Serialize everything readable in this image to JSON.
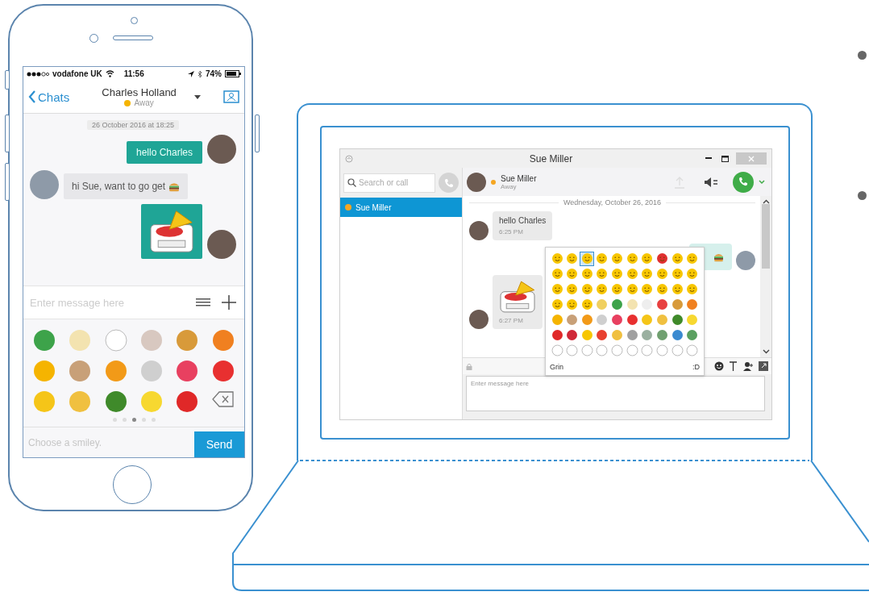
{
  "phone": {
    "status_bar": {
      "carrier": "vodafone UK",
      "time": "11:56",
      "battery": "74%"
    },
    "nav": {
      "back": "Chats",
      "contact_name": "Charles Holland",
      "presence": {
        "label": "Away",
        "color": "#f5b400"
      }
    },
    "date_label": "26 October 2016 at 18:25",
    "messages": [
      {
        "kind": "text",
        "outgoing": true,
        "text": "hello Charles"
      },
      {
        "kind": "text_emoji",
        "outgoing": false,
        "text": "hi Sue, want to go get"
      },
      {
        "kind": "sticker",
        "outgoing": true
      }
    ],
    "composer": {
      "placeholder": "Enter message here"
    },
    "emoji_pages": [
      {
        "selected": false
      },
      {
        "selected": false
      },
      {
        "selected": true
      },
      {
        "selected": false
      },
      {
        "selected": false
      }
    ],
    "footer": {
      "placeholder": "Choose a smiley.",
      "send": "Send"
    }
  },
  "desktop": {
    "window_title": "Sue Miller",
    "search": {
      "placeholder": "Search or call"
    },
    "contacts": [
      {
        "name": "Sue Miller",
        "selected": true,
        "color": "#f5a623"
      }
    ],
    "header": {
      "name": "Sue Miller",
      "presence": "Away",
      "color": "#f5a623"
    },
    "date_label": "Wednesday, October 26, 2016",
    "messages": [
      {
        "kind": "text",
        "outgoing": false,
        "text": "hello Charles",
        "time": "6:25 PM"
      },
      {
        "kind": "emoji",
        "outgoing": true
      },
      {
        "kind": "sticker",
        "outgoing": false,
        "time": "6:27 PM"
      }
    ],
    "emoji_picker": {
      "rows": [
        {
          "emojis": [
            {
              "selected": false
            },
            {
              "selected": false
            },
            {
              "selected": true
            },
            {
              "selected": false
            },
            {
              "selected": false
            },
            {
              "selected": false
            },
            {
              "selected": false
            },
            {
              "selected": false
            },
            {
              "selected": false
            },
            {
              "selected": false
            }
          ]
        },
        {
          "emojis": [
            {
              "selected": false
            },
            {
              "selected": false
            },
            {
              "selected": false
            },
            {
              "selected": false
            },
            {
              "selected": false
            },
            {
              "selected": false
            },
            {
              "selected": false
            },
            {
              "selected": false
            },
            {
              "selected": false
            },
            {
              "selected": false
            }
          ]
        },
        {
          "emojis": [
            {
              "selected": false
            },
            {
              "selected": false
            },
            {
              "selected": false
            },
            {
              "selected": false
            },
            {
              "selected": false
            },
            {
              "selected": false
            },
            {
              "selected": false
            },
            {
              "selected": false
            },
            {
              "selected": false
            },
            {
              "selected": false
            }
          ]
        },
        {
          "emojis": [
            {
              "selected": false
            },
            {
              "selected": false
            },
            {
              "selected": false
            },
            {
              "selected": false
            },
            {
              "selected": false
            },
            {
              "selected": false
            },
            {
              "selected": false
            },
            {
              "selected": false
            },
            {
              "selected": false
            },
            {
              "selected": false
            }
          ]
        },
        {
          "emojis": [
            {
              "selected": false
            },
            {
              "selected": false
            },
            {
              "selected": false
            },
            {
              "selected": false
            },
            {
              "selected": false
            },
            {
              "selected": false
            },
            {
              "selected": false
            },
            {
              "selected": false
            },
            {
              "selected": false
            },
            {
              "selected": false
            }
          ]
        },
        {
          "emojis": [
            {
              "selected": false
            },
            {
              "selected": false
            },
            {
              "selected": false
            },
            {
              "selected": false
            },
            {
              "selected": false
            },
            {
              "selected": false
            },
            {
              "selected": false
            },
            {
              "selected": false
            },
            {
              "selected": false
            },
            {
              "selected": false
            }
          ]
        },
        {
          "emojis": [
            {
              "selected": false
            },
            {
              "selected": false
            },
            {
              "selected": false
            },
            {
              "selected": false
            },
            {
              "selected": false
            },
            {
              "selected": false
            },
            {
              "selected": false
            },
            {
              "selected": false
            },
            {
              "selected": false
            },
            {
              "selected": false
            }
          ]
        }
      ],
      "name": "Grin",
      "code": ":D"
    },
    "composer": {
      "placeholder": "Enter message here"
    }
  }
}
